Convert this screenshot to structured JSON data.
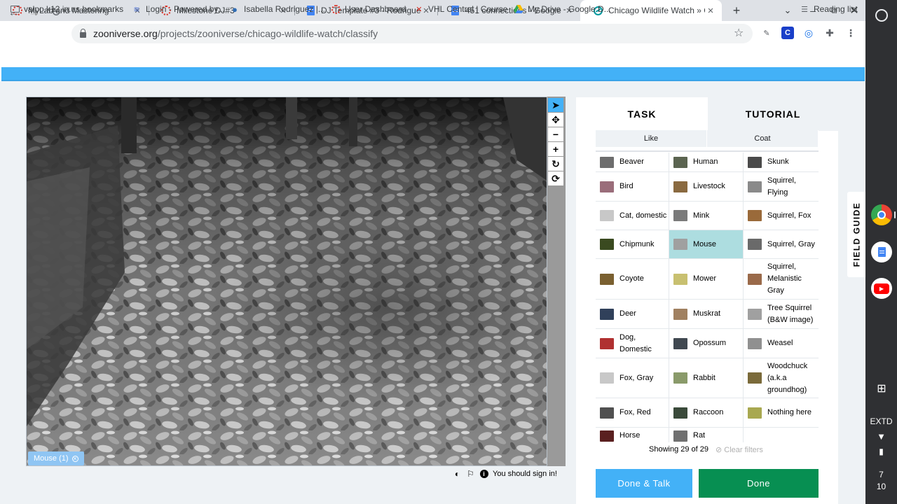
{
  "browser": {
    "tabs": [
      {
        "title": "MyLab and Mastering",
        "icon": "pearson-ring-icon"
      },
      {
        "title": "Milestone DJ#3",
        "icon": "pearson-ring-icon"
      },
      {
        "title": "DJ Template #3 - Rodriguez -",
        "icon": "google-docs-icon"
      },
      {
        "title": "451 connections - Google Do",
        "icon": "google-docs-icon"
      },
      {
        "title": "Chicago Wildlife Watch » Cla",
        "icon": "zooniverse-icon"
      }
    ],
    "new_tab": "+",
    "url_host": "zooniverse.org",
    "url_path": "/projects/zooniverse/chicago-wildlife-watch/classify",
    "bookmarks": [
      {
        "label": "valpo.k12.in.us bookmarks",
        "icon": "folder-icon"
      },
      {
        "label": "Login - Powered by...",
        "icon": "classlink-icon"
      },
      {
        "label": "Isabella Rodriguez |...",
        "icon": "globe-icon"
      },
      {
        "label": "User Dashboard",
        "icon": "pearson-ring-icon"
      },
      {
        "label": "VHL Central | Course",
        "icon": "vhl-icon"
      },
      {
        "label": "My Drive - Google D...",
        "icon": "google-drive-icon"
      }
    ],
    "reading_list": "Reading list"
  },
  "subject": {
    "mark_chip": "Mouse (1)",
    "tools": [
      "pointer-icon",
      "pan-icon",
      "zoom-out-icon",
      "zoom-in-icon",
      "rotate-icon",
      "reset-icon"
    ],
    "sign_in_note": "You should sign in!"
  },
  "task": {
    "tabs": {
      "task": "TASK",
      "tutorial": "TUTORIAL"
    },
    "filters": [
      "Like",
      "Coat"
    ],
    "choices": [
      [
        {
          "label": "Beaver",
          "color": "#6d6d6d"
        },
        {
          "label": "Human",
          "color": "#5b6450"
        },
        {
          "label": "Skunk",
          "color": "#4a4a4a"
        }
      ],
      [
        {
          "label": "Bird",
          "color": "#9a6d7a"
        },
        {
          "label": "Livestock",
          "color": "#8a6a40"
        },
        {
          "label": "Squirrel, Flying",
          "color": "#8a8a8a"
        }
      ],
      [
        {
          "label": "Cat, domestic",
          "color": "#c8c8c8"
        },
        {
          "label": "Mink",
          "color": "#7a7a7a"
        },
        {
          "label": "Squirrel, Fox",
          "color": "#9a6a3a"
        }
      ],
      [
        {
          "label": "Chipmunk",
          "color": "#3a4a20"
        },
        {
          "label": "Mouse",
          "color": "#a0a0a0"
        },
        {
          "label": "Squirrel, Gray",
          "color": "#6a6a6a"
        }
      ],
      [
        {
          "label": "Coyote",
          "color": "#7a6030"
        },
        {
          "label": "Mower",
          "color": "#c8c070"
        },
        {
          "label": "Squirrel, Melanistic Gray",
          "color": "#9a6a4a"
        }
      ],
      [
        {
          "label": "Deer",
          "color": "#30405a"
        },
        {
          "label": "Muskrat",
          "color": "#a08060"
        },
        {
          "label": "Tree Squirrel (B&W image)",
          "color": "#a0a0a0"
        }
      ],
      [
        {
          "label": "Dog, Domestic",
          "color": "#b03030"
        },
        {
          "label": "Opossum",
          "color": "#404850"
        },
        {
          "label": "Weasel",
          "color": "#909090"
        }
      ],
      [
        {
          "label": "Fox, Gray",
          "color": "#c8c8c8"
        },
        {
          "label": "Rabbit",
          "color": "#8a9a6a"
        },
        {
          "label": "Woodchuck (a.k.a groundhog)",
          "color": "#7a6a3a"
        }
      ],
      [
        {
          "label": "Fox, Red",
          "color": "#505050"
        },
        {
          "label": "Raccoon",
          "color": "#3a4a3a"
        },
        {
          "label": "Nothing here",
          "color": "#a8a850"
        }
      ],
      [
        {
          "label": "Horse",
          "color": "#5a2020"
        },
        {
          "label": "Rat",
          "color": "#707070"
        },
        {
          "label": "",
          "color": ""
        }
      ]
    ],
    "selected": "Mouse",
    "showing": "Showing 29 of 29",
    "clear_filters": "Clear filters",
    "done_talk": "Done & Talk",
    "done": "Done",
    "field_guide": "FIELD GUIDE"
  },
  "shelf": {
    "extd": "EXTD",
    "time_line1": "7",
    "time_line2": "10"
  },
  "colors": {
    "accent_blue": "#43b1f7",
    "done_green": "#078f52",
    "selected_choice": "#addde0"
  }
}
